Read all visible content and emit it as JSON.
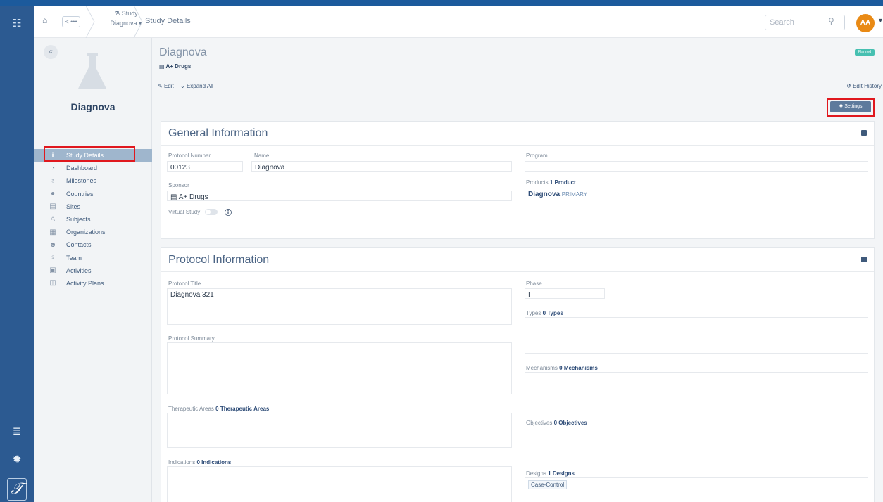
{
  "header": {
    "breadcrumb_back": "< •••",
    "breadcrumb_study_label": "Study",
    "breadcrumb_study_value": "Diagnova",
    "breadcrumb_current": "Study Details",
    "search_placeholder": "Search",
    "avatar_initials": "AA"
  },
  "sidebar": {
    "study_name": "Diagnova",
    "items": [
      {
        "label": "Study Details",
        "icon": "info-icon"
      },
      {
        "label": "Dashboard",
        "icon": "dashboard-icon"
      },
      {
        "label": "Milestones",
        "icon": "pin-icon"
      },
      {
        "label": "Countries",
        "icon": "globe-icon"
      },
      {
        "label": "Sites",
        "icon": "building-icon"
      },
      {
        "label": "Subjects",
        "icon": "subject-icon"
      },
      {
        "label": "Organizations",
        "icon": "organization-icon"
      },
      {
        "label": "Contacts",
        "icon": "contacts-icon"
      },
      {
        "label": "Team",
        "icon": "team-icon"
      },
      {
        "label": "Activities",
        "icon": "calendar-icon"
      },
      {
        "label": "Activity Plans",
        "icon": "plan-icon"
      }
    ]
  },
  "study": {
    "title": "Diagnova",
    "sponsor_sub": "A+ Drugs",
    "status": "Planned",
    "edit_label": "Edit",
    "expand_label": "Expand All",
    "history_label": "Edit History",
    "settings_label": "Settings"
  },
  "general": {
    "title": "General Information",
    "protocol_number_label": "Protocol Number",
    "protocol_number": "00123",
    "name_label": "Name",
    "name": "Diagnova",
    "program_label": "Program",
    "program": "",
    "sponsor_label": "Sponsor",
    "sponsor": "A+ Drugs",
    "products_label": "Products",
    "products_count": "1 Product",
    "product_name": "Diagnova",
    "product_tag": "PRIMARY",
    "virtual_study_label": "Virtual Study"
  },
  "protocol": {
    "title": "Protocol Information",
    "protocol_title_label": "Protocol Title",
    "protocol_title": "Diagnova 321",
    "phase_label": "Phase",
    "phase": "I",
    "types_label": "Types",
    "types_count": "0 Types",
    "summary_label": "Protocol Summary",
    "mechanisms_label": "Mechanisms",
    "mechanisms_count": "0 Mechanisms",
    "therapeutic_label": "Therapeutic Areas",
    "therapeutic_count": "0 Therapeutic Areas",
    "objectives_label": "Objectives",
    "objectives_count": "0 Objectives",
    "indications_label": "Indications",
    "indications_count": "0 Indications",
    "designs_label": "Designs",
    "designs_count": "1 Designs",
    "design_value": "Case-Control"
  }
}
